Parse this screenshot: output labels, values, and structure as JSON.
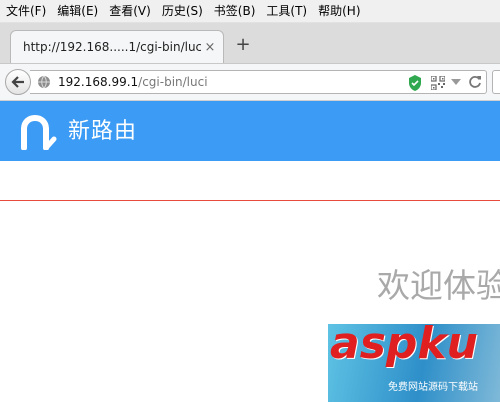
{
  "menu": {
    "items": [
      "文件(F)",
      "编辑(E)",
      "查看(V)",
      "历史(S)",
      "书签(B)",
      "工具(T)",
      "帮助(H)"
    ]
  },
  "tab": {
    "title": "http://192.168.....1/cgi-bin/luci",
    "close": "×",
    "new_tab": "+"
  },
  "address": {
    "host": "192.168.99.1",
    "path": "/cgi-bin/luci"
  },
  "icons": {
    "back": "back-arrow-icon",
    "site": "globe-icon",
    "security": "shield-check-icon",
    "qr": "qr-code-icon",
    "dropdown": "dropdown-arrow-icon",
    "reload": "reload-icon"
  },
  "brand": {
    "name": "新路由",
    "color": "#3c9bf5"
  },
  "page": {
    "welcome": "欢迎体验",
    "divider_color": "#e84b3c"
  },
  "watermark": {
    "logo": "aspku",
    "tagline": "免费网站源码下载站"
  }
}
